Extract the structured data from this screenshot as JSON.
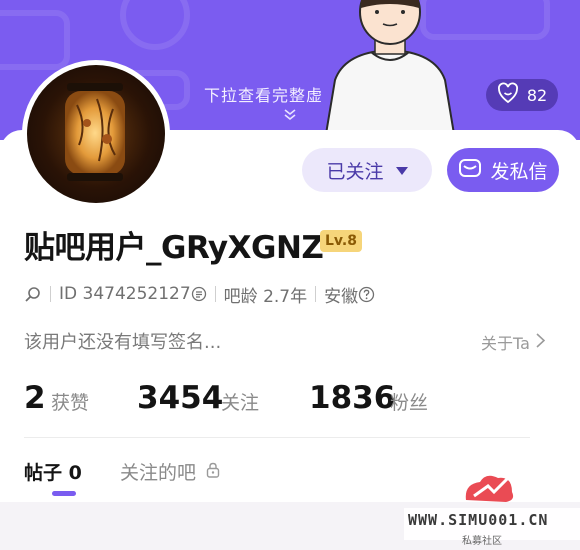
{
  "header": {
    "pull_hint": "下拉查看完整虚",
    "like_count": "82"
  },
  "actions": {
    "follow_label": "已关注",
    "message_label": "发私信"
  },
  "profile": {
    "username": "贴吧用户_GRyXGNZ",
    "level": "Lv.8",
    "id_text": "ID 3474252127",
    "age_text": "吧龄 2.7年",
    "location": "安徽",
    "bio": "该用户还没有填写签名...",
    "about_label": "关于Ta"
  },
  "stats": {
    "likes_value": "2",
    "likes_label": "获赞",
    "following_value": "3454",
    "following_label": "关注",
    "followers_value": "1836",
    "followers_label": "粉丝"
  },
  "tabs": {
    "posts_label": "帖子",
    "posts_count": "0",
    "followed_bars_label": "关注的吧"
  },
  "watermark": {
    "url": "WWW.SIMU001.CN",
    "sub": "私募社区"
  },
  "colors": {
    "accent": "#7a5cf0",
    "header_bg": "#7b5cf0",
    "level_badge": "#f6d57a"
  },
  "icons": {
    "like": "smile-heart-icon",
    "follow_dropdown": "caret-down-icon",
    "message": "mail-icon",
    "search": "search-icon",
    "copy": "copy-icon",
    "help": "question-circle-icon",
    "chevron": "chevron-right-icon",
    "lock": "lock-icon"
  }
}
